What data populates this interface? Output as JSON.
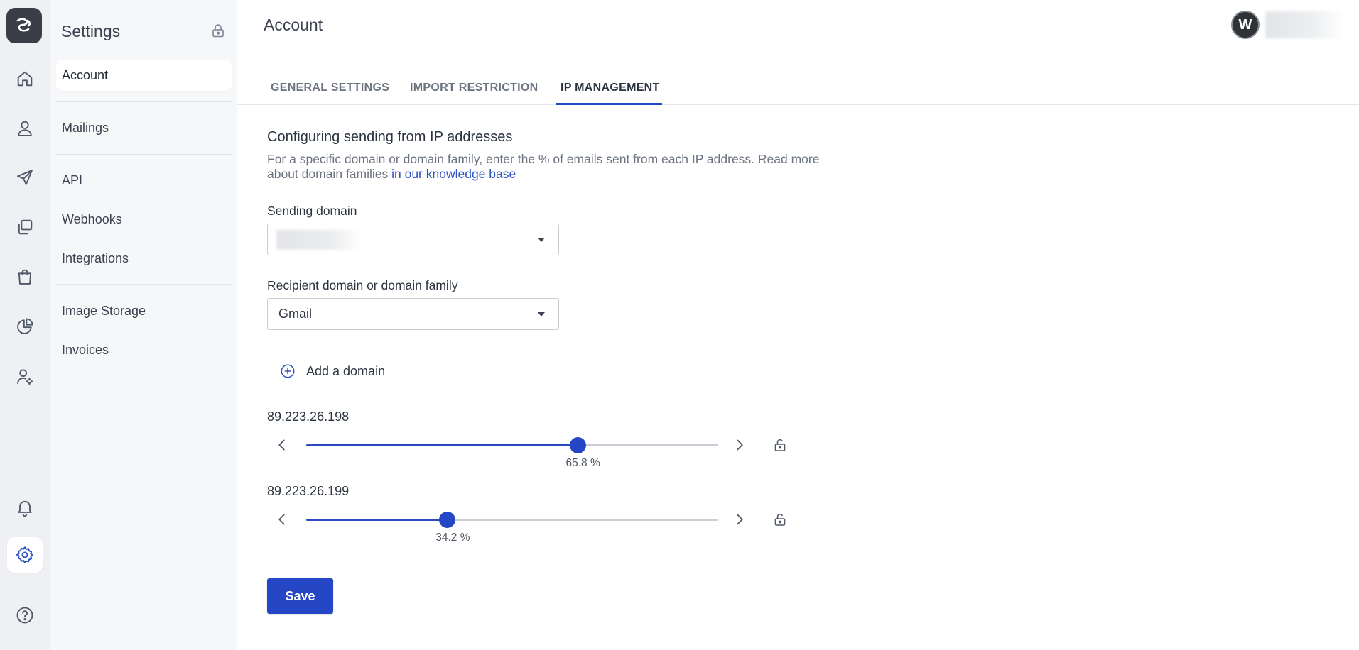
{
  "colors": {
    "accent": "#2647c5",
    "link": "#2f52c4",
    "rail_bg": "#eef0f3",
    "sidebar_bg": "#f6f7f9"
  },
  "rail": {
    "logo_icon": "brand-logo-icon",
    "items": [
      {
        "icon": "home-icon"
      },
      {
        "icon": "user-icon"
      },
      {
        "icon": "send-icon"
      },
      {
        "icon": "templates-icon"
      },
      {
        "icon": "shopping-bag-icon"
      },
      {
        "icon": "pie-chart-icon"
      },
      {
        "icon": "user-settings-icon"
      },
      {
        "icon": "bell-icon"
      },
      {
        "icon": "gear-icon",
        "active": true
      },
      {
        "icon": "help-icon"
      }
    ]
  },
  "sidebar": {
    "title": "Settings",
    "lock_icon": "lock-icon",
    "items": [
      {
        "label": "Account",
        "active": true
      },
      {
        "label": "Mailings"
      },
      {
        "label": "API"
      },
      {
        "label": "Webhooks"
      },
      {
        "label": "Integrations"
      },
      {
        "label": "Image Storage"
      },
      {
        "label": "Invoices"
      }
    ]
  },
  "header": {
    "title": "Account",
    "avatar_initial": "W"
  },
  "tabs": [
    {
      "label": "GENERAL SETTINGS"
    },
    {
      "label": "IMPORT RESTRICTION"
    },
    {
      "label": "IP MANAGEMENT",
      "active": true
    }
  ],
  "section": {
    "title": "Configuring sending from IP addresses",
    "description": "For a specific domain or domain family, enter the % of emails sent from each IP address. Read more about domain families",
    "link_text": "in our knowledge base"
  },
  "form": {
    "sending_domain": {
      "label": "Sending domain",
      "value": ""
    },
    "recipient_domain": {
      "label": "Recipient domain or domain family",
      "value": "Gmail"
    },
    "add_domain_label": "Add a domain"
  },
  "ips": [
    {
      "address": "89.223.26.198",
      "percent": 65.8,
      "percent_label": "65.8 %"
    },
    {
      "address": "89.223.26.199",
      "percent": 34.2,
      "percent_label": "34.2 %"
    }
  ],
  "save_label": "Save"
}
